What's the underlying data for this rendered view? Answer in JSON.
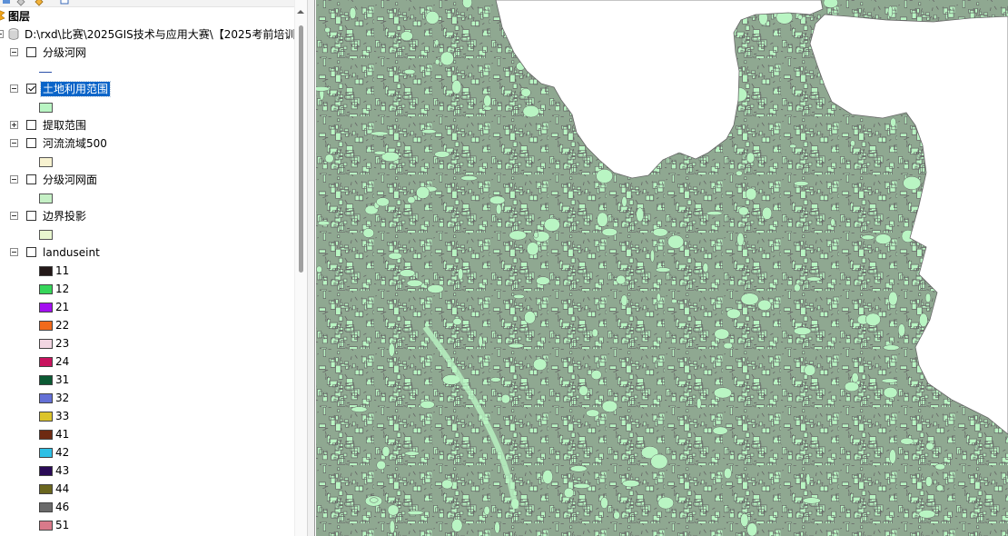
{
  "toc": {
    "title": "图层",
    "data_frame_path": "D:\\rxd\\比赛\\2025GIS技术与应用大赛\\【2025考前培训",
    "layers": [
      {
        "name": "分级河网",
        "checked": false,
        "expanded": true,
        "legend": {
          "kind": "line",
          "color": "#2a4fa8"
        }
      },
      {
        "name": "土地利用范围",
        "checked": true,
        "expanded": true,
        "selected": true,
        "legend": {
          "kind": "fill",
          "color": "#b9f5c3"
        }
      },
      {
        "name": "提取范围",
        "checked": false,
        "expanded": false
      },
      {
        "name": "河流流域500",
        "checked": false,
        "expanded": true,
        "legend": {
          "kind": "fill",
          "color": "#f7f2d0"
        }
      },
      {
        "name": "分级河网面",
        "checked": false,
        "expanded": true,
        "legend": {
          "kind": "fill",
          "color": "#c5f0c5"
        }
      },
      {
        "name": "边界投影",
        "checked": false,
        "expanded": true,
        "legend": {
          "kind": "fill",
          "color": "#e8f7cf"
        }
      },
      {
        "name": "landuseint",
        "checked": false,
        "expanded": true,
        "classes": [
          {
            "label": "11",
            "color": "#231818"
          },
          {
            "label": "12",
            "color": "#36d65a"
          },
          {
            "label": "21",
            "color": "#a30ff0"
          },
          {
            "label": "22",
            "color": "#f26a1b"
          },
          {
            "label": "23",
            "color": "#f2d6e2"
          },
          {
            "label": "24",
            "color": "#c8135e"
          },
          {
            "label": "31",
            "color": "#0b5a33"
          },
          {
            "label": "32",
            "color": "#6470d6"
          },
          {
            "label": "33",
            "color": "#dcc42a"
          },
          {
            "label": "41",
            "color": "#6e2a12"
          },
          {
            "label": "42",
            "color": "#2ec0e6"
          },
          {
            "label": "43",
            "color": "#2a0a56"
          },
          {
            "label": "44",
            "color": "#6a661e"
          },
          {
            "label": "46",
            "color": "#6a6a6a"
          },
          {
            "label": "51",
            "color": "#d97a8a"
          }
        ]
      }
    ]
  },
  "map": {
    "fill_color": "#b9f5c3",
    "parcel_outline_color": "#666666",
    "background_color": "#ffffff"
  }
}
